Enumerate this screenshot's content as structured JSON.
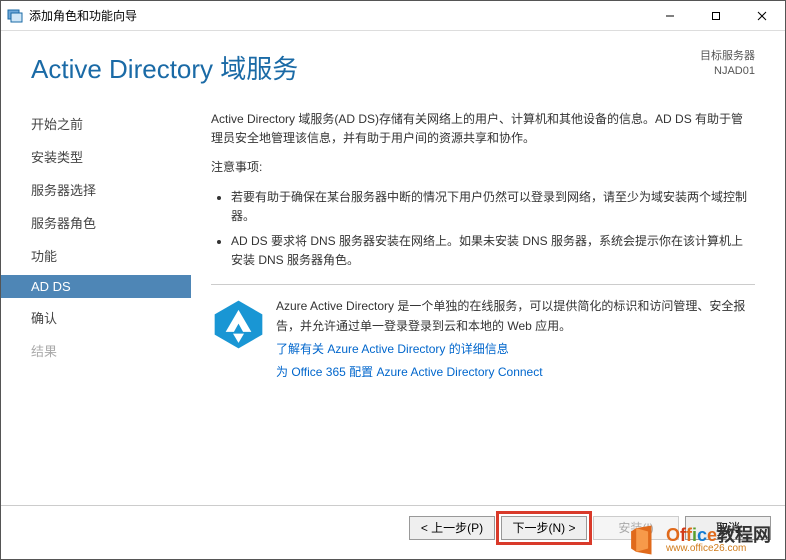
{
  "window": {
    "title": "添加角色和功能向导"
  },
  "header": {
    "page_title": "Active Directory 域服务",
    "dest_label": "目标服务器",
    "dest_value": "NJAD01"
  },
  "sidebar": {
    "items": [
      {
        "label": "开始之前"
      },
      {
        "label": "安装类型"
      },
      {
        "label": "服务器选择"
      },
      {
        "label": "服务器角色"
      },
      {
        "label": "功能"
      },
      {
        "label": "AD DS"
      },
      {
        "label": "确认"
      },
      {
        "label": "结果"
      }
    ]
  },
  "main": {
    "intro": "Active Directory 域服务(AD DS)存储有关网络上的用户、计算机和其他设备的信息。AD DS 有助于管理员安全地管理该信息，并有助于用户间的资源共享和协作。",
    "notes_label": "注意事项:",
    "bullets": [
      "若要有助于确保在某台服务器中断的情况下用户仍然可以登录到网络，请至少为域安装两个域控制器。",
      "AD DS 要求将 DNS 服务器安装在网络上。如果未安装 DNS 服务器，系统会提示你在该计算机上安装 DNS 服务器角色。"
    ],
    "aad_desc": "Azure Active Directory 是一个单独的在线服务，可以提供简化的标识和访问管理、安全报告，并允许通过单一登录登录到云和本地的 Web 应用。",
    "link1": "了解有关 Azure Active Directory 的详细信息",
    "link2": "为 Office 365 配置 Azure Active Directory Connect"
  },
  "buttons": {
    "prev": "< 上一步(P)",
    "next": "下一步(N) >",
    "install": "安装(I)",
    "cancel": "取消"
  },
  "watermark": {
    "brand": "Office",
    "suffix": "教程网",
    "url": "www.office26.com"
  }
}
